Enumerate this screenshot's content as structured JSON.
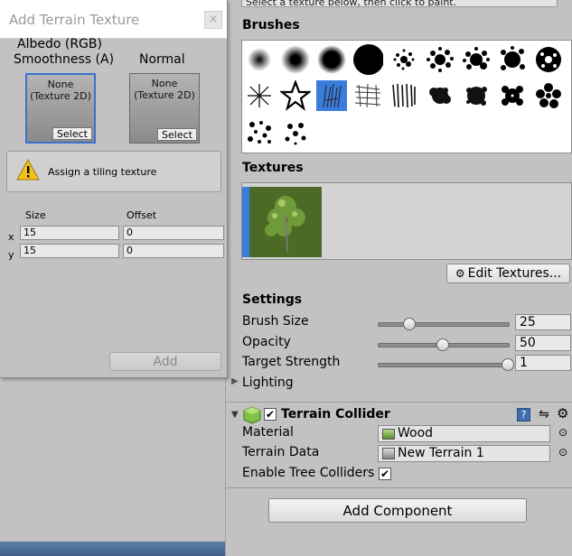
{
  "inspector": {
    "top_hint": "Select a texture below, then click to paint.",
    "brushes_label": "Brushes",
    "textures_label": "Textures",
    "edit_textures_label": "Edit Textures...",
    "settings_label": "Settings",
    "settings": [
      {
        "label": "Brush Size",
        "value": "25",
        "fraction": 0.24
      },
      {
        "label": "Opacity",
        "value": "50",
        "fraction": 0.5
      },
      {
        "label": "Target Strength",
        "value": "1",
        "fraction": 1.0
      }
    ],
    "lighting_label": "Lighting",
    "collider": {
      "title": "Terrain Collider",
      "material_label": "Material",
      "material_value": "Wood",
      "terrain_data_label": "Terrain Data",
      "terrain_data_value": "New Terrain 1",
      "enable_tree_colliders_label": "Enable Tree Colliders"
    },
    "add_component_label": "Add Component",
    "accent_color": "#3b7ddd"
  },
  "dialog": {
    "title": "Add Terrain Texture",
    "close_glyph": "×",
    "albedo_label_line1": "Albedo (RGB)",
    "albedo_label_line2": "Smoothness (A)",
    "normal_label": "Normal",
    "slot_text_line1": "None",
    "slot_text_line2": "(Texture 2D)",
    "select_label": "Select",
    "warning_text": "Assign a tiling texture",
    "size_label": "Size",
    "offset_label": "Offset",
    "x_label": "x",
    "y_label": "y",
    "size_x": "15",
    "size_y": "15",
    "offset_x": "0",
    "offset_y": "0",
    "add_label": "Add"
  }
}
